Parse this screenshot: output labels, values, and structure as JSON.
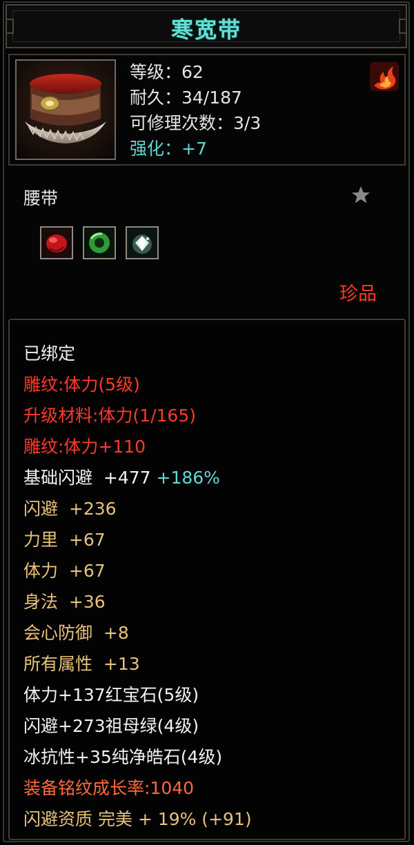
{
  "item": {
    "name": "寒宽带",
    "level_line": "等级：62",
    "durability_line": "耐久：34/187",
    "repairs_line": "可修理次数：3/3",
    "enhance_line": "强化：+7",
    "type": "腰带",
    "quality": "珍品"
  },
  "icons": {
    "item_icon": "fur-belt-icon",
    "rarity_icon": "flame-rarity-icon",
    "favorite_icon": "star-icon",
    "gems": [
      "ruby-gem-icon",
      "emerald-gem-icon",
      "diamond-gem-icon"
    ]
  },
  "attributes": {
    "bound": "已绑定",
    "engrave_1": "雕纹:体力(5级)",
    "upgrade_material": "升级材料:体力(1/165)",
    "engrave_2": "雕纹:体力+110",
    "base_dodge_label": "基础闪避  +477",
    "base_dodge_bonus": "+186%",
    "stat_dodge": "闪避  +236",
    "stat_strength": "力里  +67",
    "stat_stamina": "体力  +67",
    "stat_agility": "身法  +36",
    "stat_crit_def": "会心防御  +8",
    "stat_all": "所有属性  +13",
    "gem_1": "体力+137红宝石(5级)",
    "gem_2": "闪避+273祖母绿(4级)",
    "gem_3": "冰抗性+35纯净皓石(4级)",
    "growth": "装备铭纹成长率:1040",
    "aptitude": "闪避资质 完美 + 19% (+91)"
  },
  "colors": {
    "title": "#63e0d6",
    "enhance": "#5fd6d4",
    "engrave": "#ff3a2a",
    "stat": "#e8c27a",
    "quality": "#ff3a1e",
    "growth": "#ff6a3a"
  }
}
